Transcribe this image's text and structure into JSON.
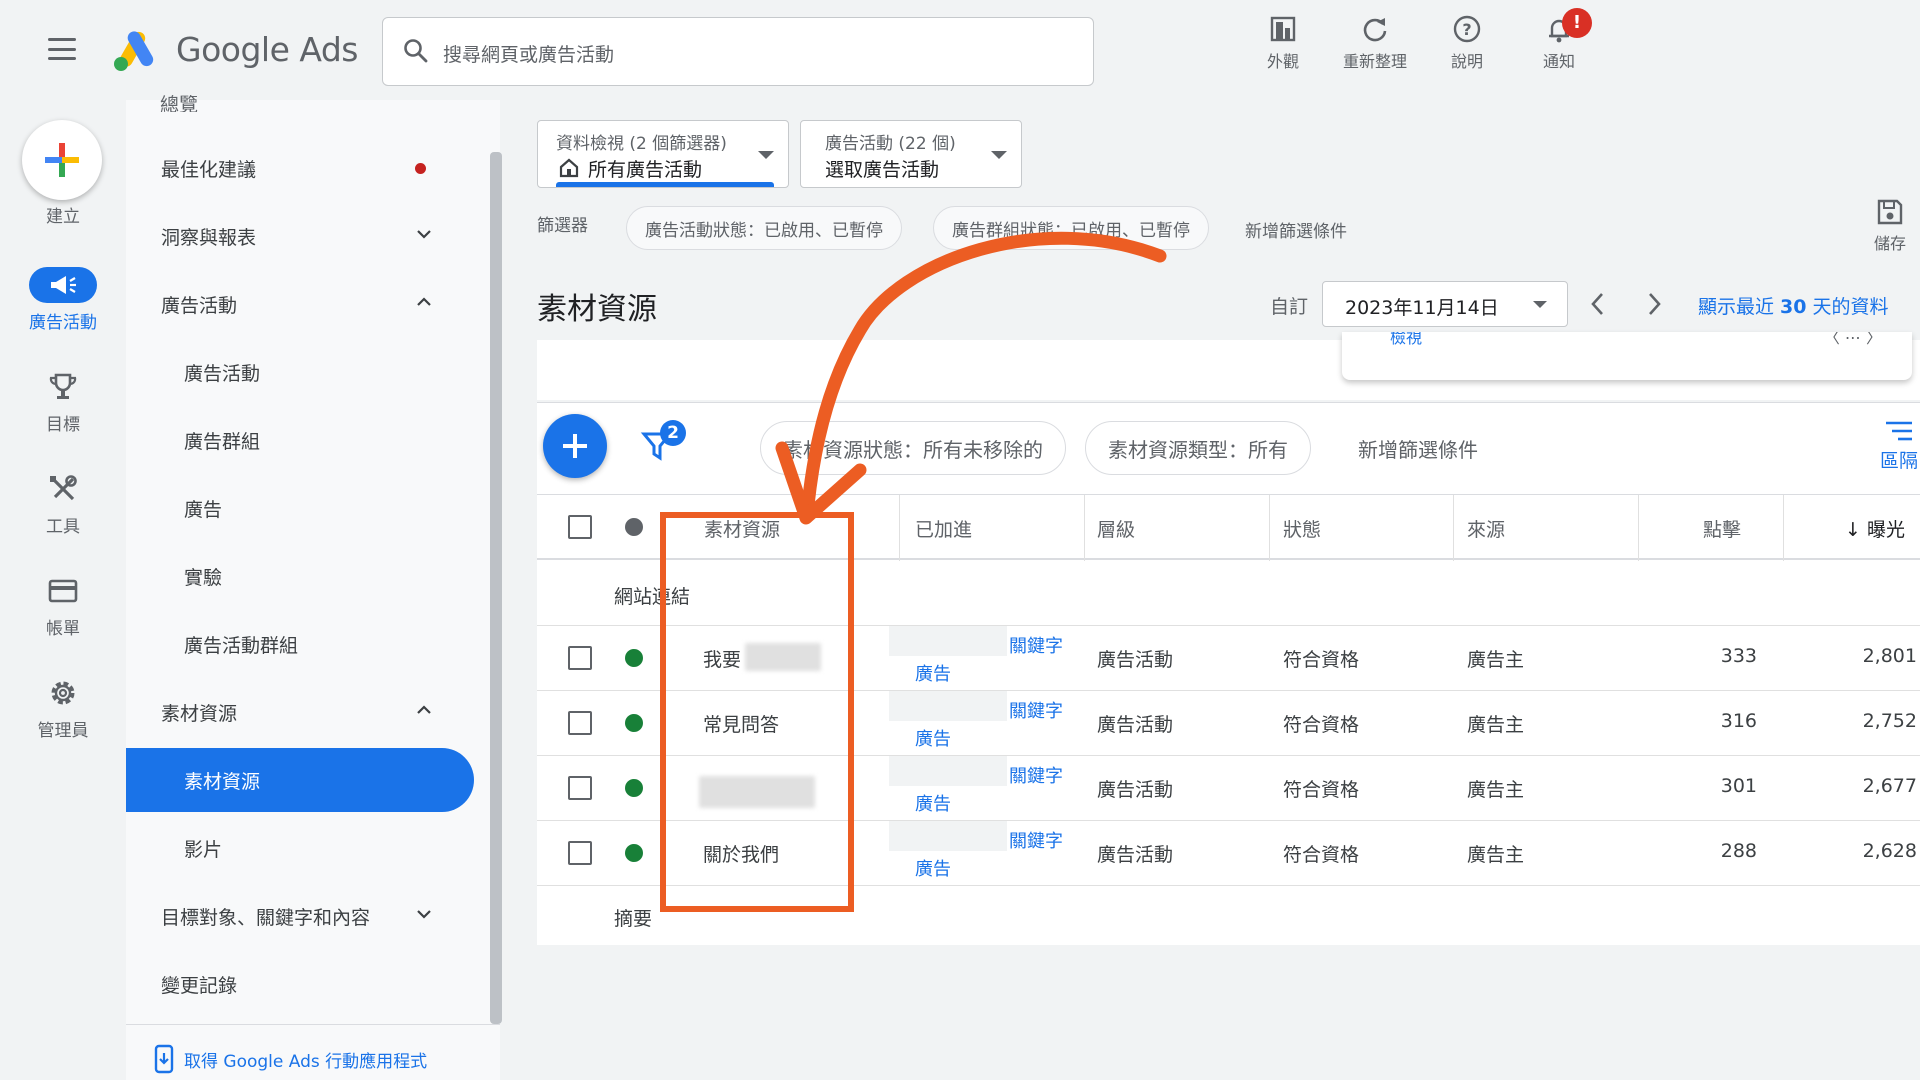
{
  "app": {
    "brand": "Google Ads",
    "search_placeholder": "搜尋網頁或廣告活動"
  },
  "top_actions": [
    {
      "label": "外觀",
      "icon": "appearance-icon"
    },
    {
      "label": "重新整理",
      "icon": "refresh-icon"
    },
    {
      "label": "說明",
      "icon": "help-icon"
    },
    {
      "label": "通知",
      "icon": "bell-icon",
      "badge": "!"
    }
  ],
  "rail": {
    "create": "建立",
    "items": [
      {
        "label": "廣告活動",
        "icon": "megaphone-icon",
        "active": true
      },
      {
        "label": "目標",
        "icon": "trophy-icon"
      },
      {
        "label": "工具",
        "icon": "tools-icon"
      },
      {
        "label": "帳單",
        "icon": "credit-card-icon"
      },
      {
        "label": "管理員",
        "icon": "gear-icon"
      }
    ]
  },
  "sidenav": {
    "cut_top": "總覽",
    "items": [
      {
        "label": "最佳化建議",
        "level": 1,
        "indicator": "dot"
      },
      {
        "label": "洞察與報表",
        "level": 1,
        "indicator": "chevron-down"
      },
      {
        "label": "廣告活動",
        "level": 1,
        "indicator": "chevron-up"
      },
      {
        "label": "廣告活動",
        "level": 2
      },
      {
        "label": "廣告群組",
        "level": 2
      },
      {
        "label": "廣告",
        "level": 2
      },
      {
        "label": "實驗",
        "level": 2
      },
      {
        "label": "廣告活動群組",
        "level": 2
      },
      {
        "label": "素材資源",
        "level": 1,
        "indicator": "chevron-up"
      },
      {
        "label": "素材資源",
        "level": 2,
        "selected": true
      },
      {
        "label": "影片",
        "level": 2
      },
      {
        "label": "目標對象、關鍵字和內容",
        "level": 1,
        "indicator": "chevron-down"
      },
      {
        "label": "變更記錄",
        "level": 1
      }
    ],
    "app_link": "取得 Google Ads 行動應用程式"
  },
  "view_selector": {
    "small": "資料檢視 (2 個篩選器)",
    "big": "所有廣告活動"
  },
  "campaign_selector": {
    "small": "廣告活動 (22 個)",
    "big": "選取廣告活動"
  },
  "filters": {
    "label": "篩選器",
    "chips": [
      "廣告活動狀態：已啟用、已暫停",
      "廣告群組狀態：已啟用、已暫停"
    ],
    "add": "新增篩選條件",
    "save": "儲存"
  },
  "page": {
    "title": "素材資源",
    "custom": "自訂",
    "date": "2023年11月14日",
    "last30_prefix": "顯示最近 ",
    "last30_num": "30",
    "last30_suffix": " 天的資料",
    "popup_cut_left": "檢視",
    "popup_cut_right": "〈 ⋯ 〉"
  },
  "table_toolbar": {
    "filter_count": "2",
    "chips": [
      "素材資源狀態：所有未移除的",
      "素材資源類型：所有"
    ],
    "add": "新增篩選條件",
    "columns": "區隔"
  },
  "table": {
    "headers": {
      "asset": "素材資源",
      "added": "已加進",
      "level": "層級",
      "status": "狀態",
      "source": "來源",
      "clicks": "點擊",
      "impressions": "↓ 曝光"
    },
    "group": "網站連結",
    "rows": [
      {
        "asset": "我要",
        "added_a": "關鍵字",
        "added_b": "廣告",
        "level": "廣告活動",
        "status": "符合資格",
        "source": "廣告主",
        "clicks": "333",
        "impressions": "2,801"
      },
      {
        "asset": "常見問答",
        "added_a": "關鍵字",
        "added_b": "廣告",
        "level": "廣告活動",
        "status": "符合資格",
        "source": "廣告主",
        "clicks": "316",
        "impressions": "2,752"
      },
      {
        "asset": "",
        "added_a": "關鍵字",
        "added_b": "廣告",
        "level": "廣告活動",
        "status": "符合資格",
        "source": "廣告主",
        "clicks": "301",
        "impressions": "2,677"
      },
      {
        "asset": "關於我們",
        "added_a": "關鍵字",
        "added_b": "廣告",
        "level": "廣告活動",
        "status": "符合資格",
        "source": "廣告主",
        "clicks": "288",
        "impressions": "2,628"
      }
    ],
    "summary": "摘要"
  },
  "colors": {
    "accent": "#1a73e8",
    "highlight": "#ec5d23",
    "eligible": "#188038",
    "alert": "#d93025"
  }
}
